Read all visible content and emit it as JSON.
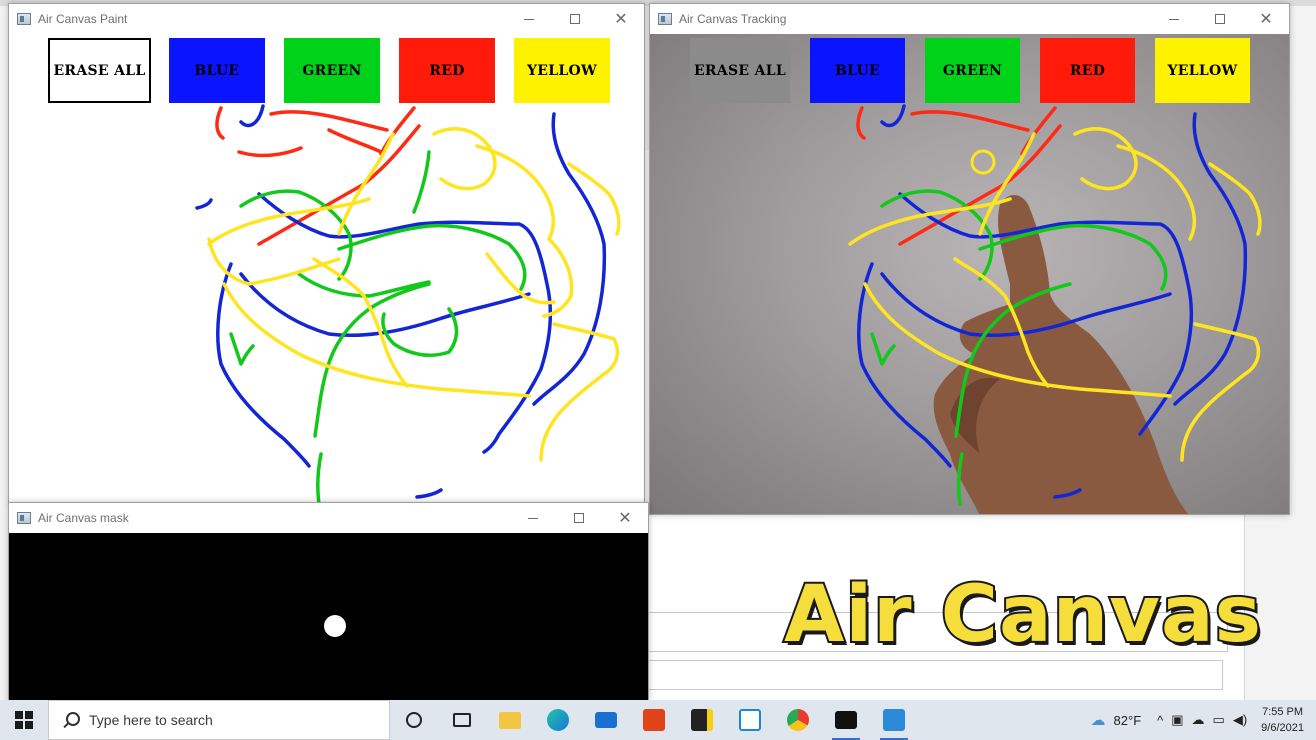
{
  "windows": {
    "paint": {
      "title": "Air Canvas Paint"
    },
    "tracking": {
      "title": "Air Canvas Tracking"
    },
    "mask": {
      "title": "Air Canvas mask"
    }
  },
  "palette": [
    {
      "label": "ERASE ALL",
      "color": "#ffffff"
    },
    {
      "label": "BLUE",
      "color": "#0a14ff"
    },
    {
      "label": "GREEN",
      "color": "#00d21a"
    },
    {
      "label": "RED",
      "color": "#ff1a0a"
    },
    {
      "label": "YELLOW",
      "color": "#fff200"
    }
  ],
  "stroke_colors": {
    "blue": "#1326d6",
    "green": "#12c81a",
    "red": "#ff2a14",
    "yellow": "#ffe51f"
  },
  "overlay": {
    "text": "Air Canvas"
  },
  "taskbar": {
    "search_placeholder": "Type here to search",
    "weather": "82°F",
    "time": "7:55 PM",
    "date": "9/6/2021",
    "pinned": [
      "task-view",
      "file-explorer",
      "edge",
      "mail",
      "office",
      "sticky-notes",
      "snip",
      "chrome",
      "terminal",
      "media-player"
    ]
  },
  "window_controls": {
    "close_symbol": "✕"
  }
}
